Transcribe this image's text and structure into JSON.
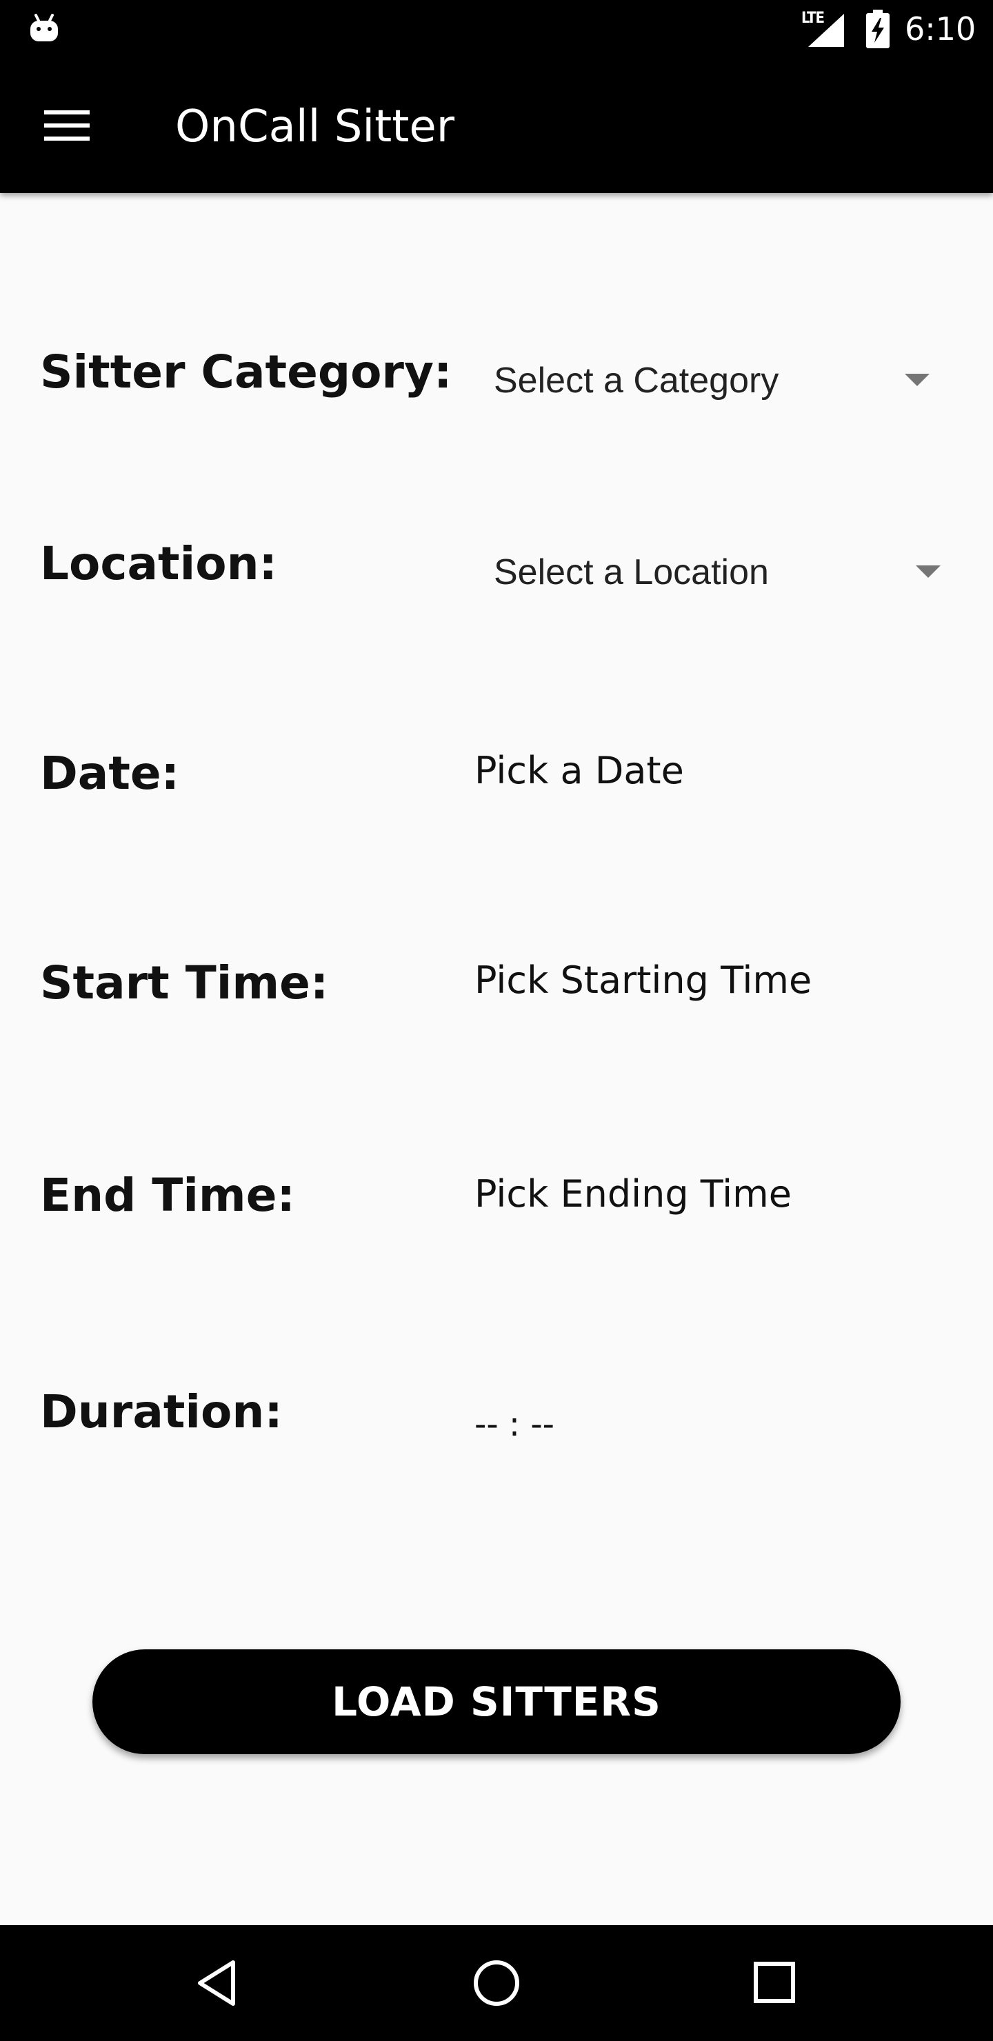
{
  "status_bar": {
    "network_label": "LTE",
    "time": "6:10"
  },
  "toolbar": {
    "title": "OnCall Sitter"
  },
  "form": {
    "category": {
      "label": "Sitter Category:",
      "value": "Select a Category"
    },
    "location": {
      "label": "Location:",
      "value": "Select a Location"
    },
    "date": {
      "label": "Date:",
      "value": "Pick a Date"
    },
    "start_time": {
      "label": "Start Time:",
      "value": "Pick Starting Time"
    },
    "end_time": {
      "label": "End Time:",
      "value": "Pick Ending Time"
    },
    "duration": {
      "label": "Duration:",
      "value": "-- : --"
    }
  },
  "actions": {
    "load_button_label": "LOAD SITTERS"
  },
  "colors": {
    "bar_background": "#000000",
    "page_background": "#fafafa",
    "spinner_arrow": "#757575"
  },
  "icons": {
    "status_left": "android-debug-icon",
    "signal": "signal-icon",
    "battery": "battery-charging-icon",
    "menu": "hamburger-menu-icon",
    "nav_back": "back-triangle-icon",
    "nav_home": "home-circle-icon",
    "nav_recents": "recents-square-icon"
  }
}
